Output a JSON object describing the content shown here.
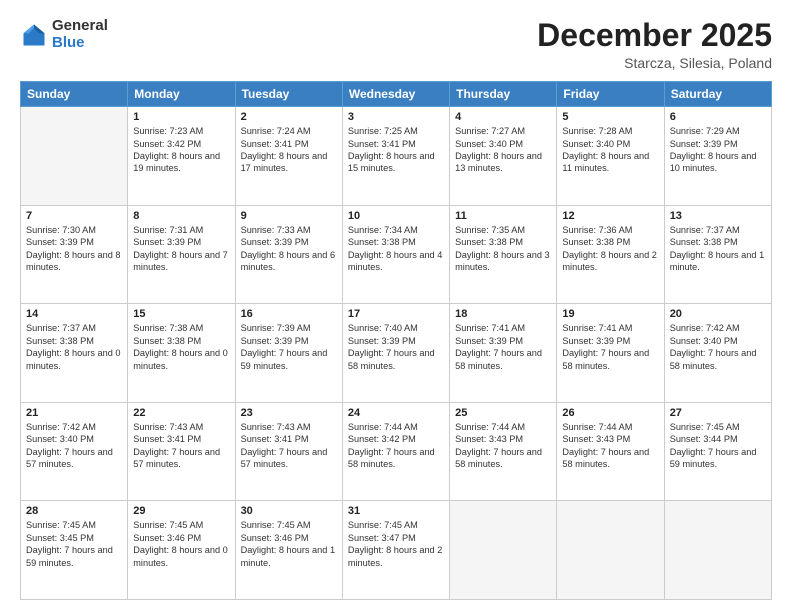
{
  "header": {
    "logo_general": "General",
    "logo_blue": "Blue",
    "title": "December 2025",
    "location": "Starcza, Silesia, Poland"
  },
  "days_of_week": [
    "Sunday",
    "Monday",
    "Tuesday",
    "Wednesday",
    "Thursday",
    "Friday",
    "Saturday"
  ],
  "weeks": [
    [
      {
        "day": "",
        "empty": true
      },
      {
        "day": "1",
        "sunrise": "7:23 AM",
        "sunset": "3:42 PM",
        "daylight": "8 hours and 19 minutes."
      },
      {
        "day": "2",
        "sunrise": "7:24 AM",
        "sunset": "3:41 PM",
        "daylight": "8 hours and 17 minutes."
      },
      {
        "day": "3",
        "sunrise": "7:25 AM",
        "sunset": "3:41 PM",
        "daylight": "8 hours and 15 minutes."
      },
      {
        "day": "4",
        "sunrise": "7:27 AM",
        "sunset": "3:40 PM",
        "daylight": "8 hours and 13 minutes."
      },
      {
        "day": "5",
        "sunrise": "7:28 AM",
        "sunset": "3:40 PM",
        "daylight": "8 hours and 11 minutes."
      },
      {
        "day": "6",
        "sunrise": "7:29 AM",
        "sunset": "3:39 PM",
        "daylight": "8 hours and 10 minutes."
      }
    ],
    [
      {
        "day": "7",
        "sunrise": "7:30 AM",
        "sunset": "3:39 PM",
        "daylight": "8 hours and 8 minutes."
      },
      {
        "day": "8",
        "sunrise": "7:31 AM",
        "sunset": "3:39 PM",
        "daylight": "8 hours and 7 minutes."
      },
      {
        "day": "9",
        "sunrise": "7:33 AM",
        "sunset": "3:39 PM",
        "daylight": "8 hours and 6 minutes."
      },
      {
        "day": "10",
        "sunrise": "7:34 AM",
        "sunset": "3:38 PM",
        "daylight": "8 hours and 4 minutes."
      },
      {
        "day": "11",
        "sunrise": "7:35 AM",
        "sunset": "3:38 PM",
        "daylight": "8 hours and 3 minutes."
      },
      {
        "day": "12",
        "sunrise": "7:36 AM",
        "sunset": "3:38 PM",
        "daylight": "8 hours and 2 minutes."
      },
      {
        "day": "13",
        "sunrise": "7:37 AM",
        "sunset": "3:38 PM",
        "daylight": "8 hours and 1 minute."
      }
    ],
    [
      {
        "day": "14",
        "sunrise": "7:37 AM",
        "sunset": "3:38 PM",
        "daylight": "8 hours and 0 minutes."
      },
      {
        "day": "15",
        "sunrise": "7:38 AM",
        "sunset": "3:38 PM",
        "daylight": "8 hours and 0 minutes."
      },
      {
        "day": "16",
        "sunrise": "7:39 AM",
        "sunset": "3:39 PM",
        "daylight": "7 hours and 59 minutes."
      },
      {
        "day": "17",
        "sunrise": "7:40 AM",
        "sunset": "3:39 PM",
        "daylight": "7 hours and 58 minutes."
      },
      {
        "day": "18",
        "sunrise": "7:41 AM",
        "sunset": "3:39 PM",
        "daylight": "7 hours and 58 minutes."
      },
      {
        "day": "19",
        "sunrise": "7:41 AM",
        "sunset": "3:39 PM",
        "daylight": "7 hours and 58 minutes."
      },
      {
        "day": "20",
        "sunrise": "7:42 AM",
        "sunset": "3:40 PM",
        "daylight": "7 hours and 58 minutes."
      }
    ],
    [
      {
        "day": "21",
        "sunrise": "7:42 AM",
        "sunset": "3:40 PM",
        "daylight": "7 hours and 57 minutes."
      },
      {
        "day": "22",
        "sunrise": "7:43 AM",
        "sunset": "3:41 PM",
        "daylight": "7 hours and 57 minutes."
      },
      {
        "day": "23",
        "sunrise": "7:43 AM",
        "sunset": "3:41 PM",
        "daylight": "7 hours and 57 minutes."
      },
      {
        "day": "24",
        "sunrise": "7:44 AM",
        "sunset": "3:42 PM",
        "daylight": "7 hours and 58 minutes."
      },
      {
        "day": "25",
        "sunrise": "7:44 AM",
        "sunset": "3:43 PM",
        "daylight": "7 hours and 58 minutes."
      },
      {
        "day": "26",
        "sunrise": "7:44 AM",
        "sunset": "3:43 PM",
        "daylight": "7 hours and 58 minutes."
      },
      {
        "day": "27",
        "sunrise": "7:45 AM",
        "sunset": "3:44 PM",
        "daylight": "7 hours and 59 minutes."
      }
    ],
    [
      {
        "day": "28",
        "sunrise": "7:45 AM",
        "sunset": "3:45 PM",
        "daylight": "7 hours and 59 minutes."
      },
      {
        "day": "29",
        "sunrise": "7:45 AM",
        "sunset": "3:46 PM",
        "daylight": "8 hours and 0 minutes."
      },
      {
        "day": "30",
        "sunrise": "7:45 AM",
        "sunset": "3:46 PM",
        "daylight": "8 hours and 1 minute."
      },
      {
        "day": "31",
        "sunrise": "7:45 AM",
        "sunset": "3:47 PM",
        "daylight": "8 hours and 2 minutes."
      },
      {
        "day": "",
        "empty": true
      },
      {
        "day": "",
        "empty": true
      },
      {
        "day": "",
        "empty": true
      }
    ]
  ]
}
